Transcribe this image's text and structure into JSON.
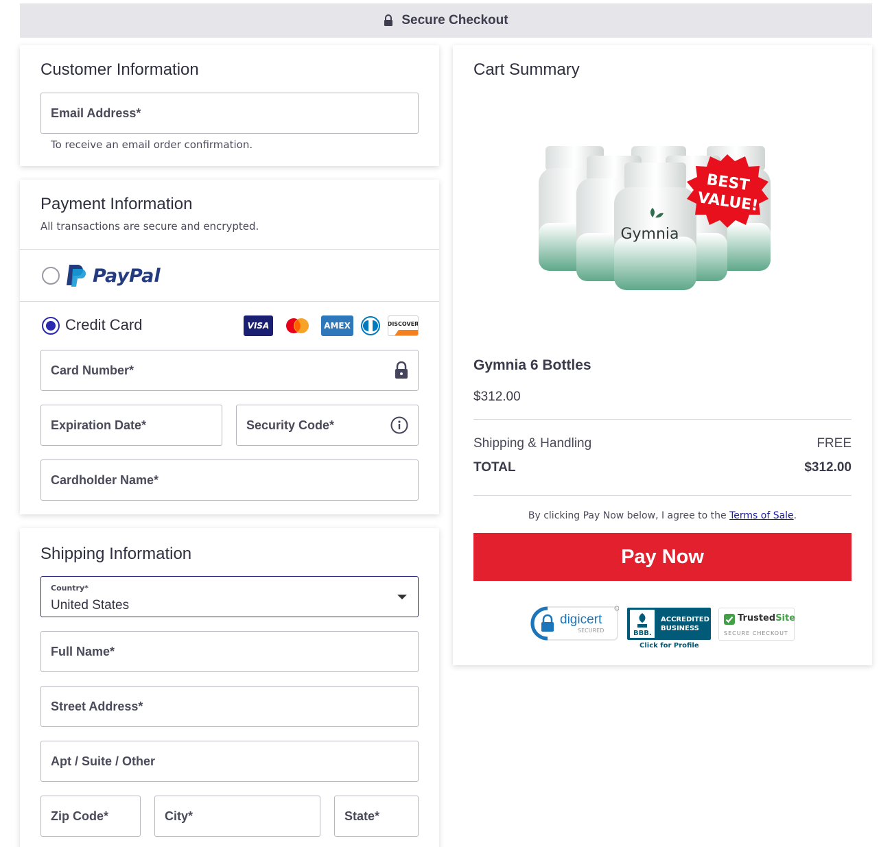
{
  "header": {
    "title": "Secure Checkout"
  },
  "customer": {
    "title": "Customer Information",
    "email_placeholder": "Email Address*",
    "email_hint": "To receive an email order confirmation."
  },
  "payment": {
    "title": "Payment Information",
    "subtitle": "All transactions are secure and encrypted.",
    "paypal_label": "PayPal",
    "paypal_selected": false,
    "credit_label": "Credit Card",
    "credit_selected": true,
    "card_logos": [
      "VISA",
      "mastercard",
      "AMEX",
      "diners",
      "DISCOVER"
    ],
    "card_number": "Card Number*",
    "expiration": "Expiration Date*",
    "security_code": "Security Code*",
    "cardholder": "Cardholder Name*"
  },
  "shipping": {
    "title": "Shipping Information",
    "country_label": "Country*",
    "country_value": "United States",
    "full_name": "Full Name*",
    "street": "Street Address*",
    "apt": "Apt / Suite / Other",
    "zip": "Zip Code*",
    "city": "City*",
    "state": "State*"
  },
  "cart": {
    "title": "Cart Summary",
    "product_brand": "Gymnia",
    "badge_line1": "BEST",
    "badge_line2": "VALUE!",
    "product_name": "Gymnia 6 Bottles",
    "product_price": "$312.00",
    "shipping_label": "Shipping & Handling",
    "shipping_value": "FREE",
    "total_label": "TOTAL",
    "total_value": "$312.00",
    "terms_prefix": "By clicking Pay Now below, I agree to the ",
    "terms_link": "Terms of Sale",
    "terms_suffix": ".",
    "pay_button": "Pay Now",
    "trust": {
      "digicert": "digicert",
      "digicert_sub": "SECURED",
      "bbb_line1": "ACCREDITED",
      "bbb_line2": "BUSINESS",
      "bbb_logo": "BBB.",
      "bbb_caption": "Click for Profile",
      "trusted_main": "Trusted",
      "trusted_accent": "Site",
      "trusted_sub": "SECURE CHECKOUT"
    }
  },
  "colors": {
    "accent": "#2a2ab0",
    "pay": "#e3202e",
    "link": "#1a1aa8"
  }
}
